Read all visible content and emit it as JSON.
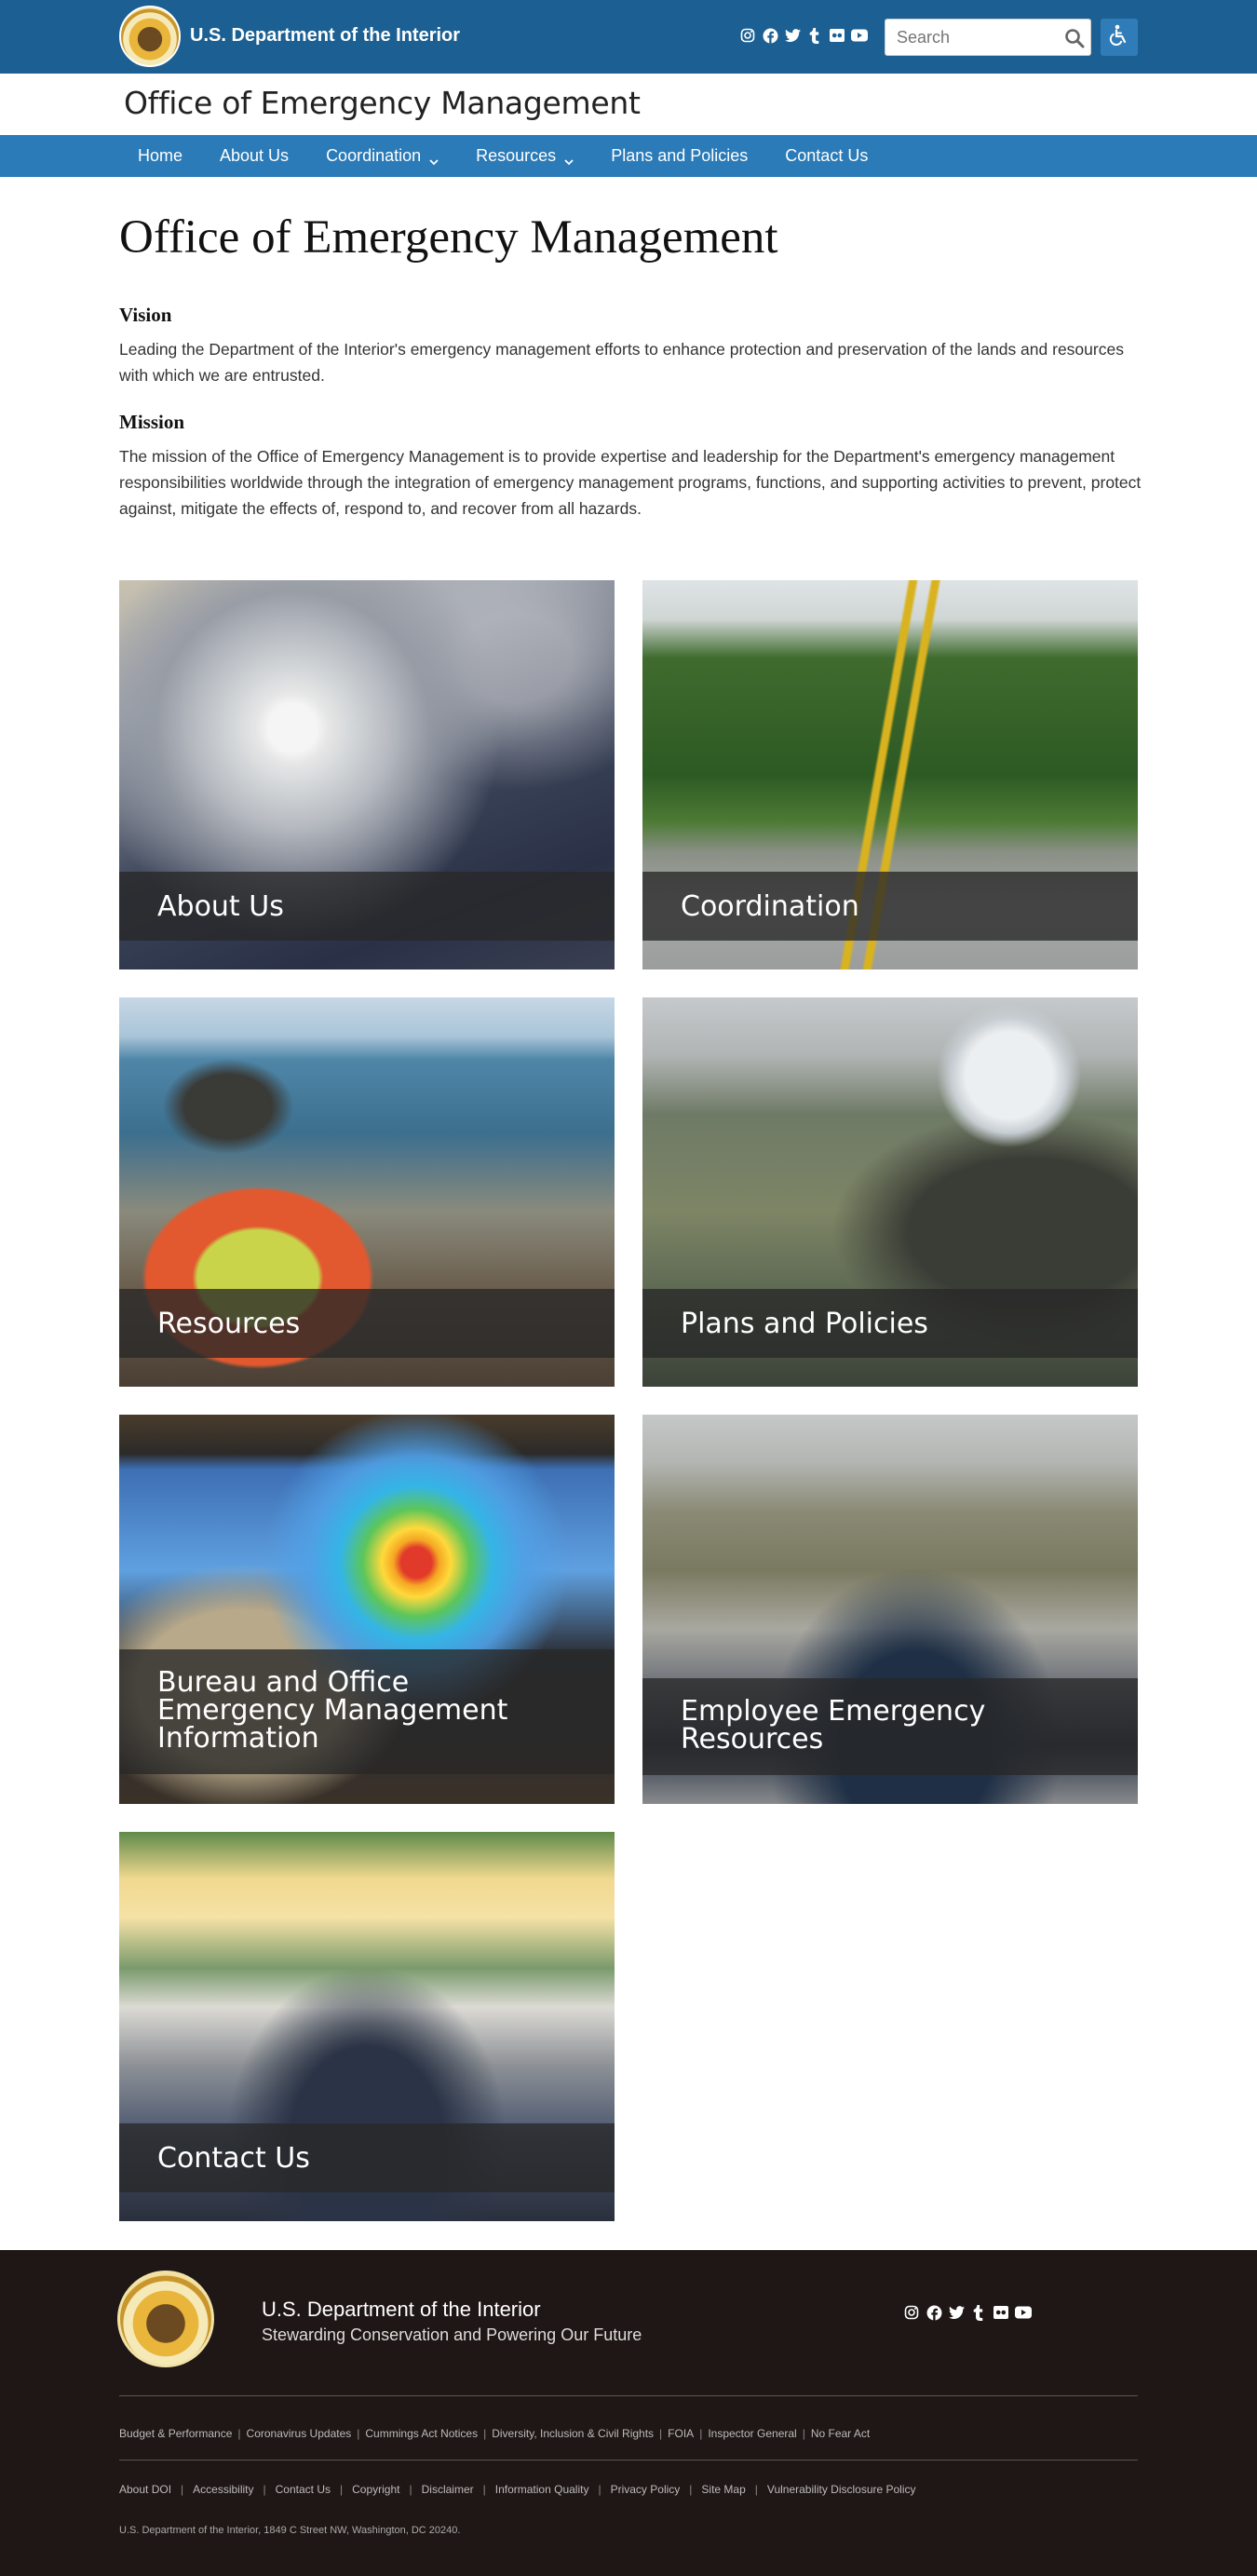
{
  "header": {
    "agency_name": "U.S. Department of the Interior",
    "search_placeholder": "Search",
    "social_icons": [
      "instagram-icon",
      "facebook-icon",
      "twitter-icon",
      "tumblr-icon",
      "flickr-icon",
      "youtube-icon"
    ],
    "colors": {
      "topbar": "#1c6093",
      "nav": "#2b7bb8"
    }
  },
  "site_title": "Office of Emergency Management",
  "nav": {
    "items": [
      {
        "label": "Home"
      },
      {
        "label": "About Us"
      },
      {
        "label": "Coordination"
      },
      {
        "label": "Resources"
      },
      {
        "label": "Plans and Policies"
      },
      {
        "label": "Contact Us"
      }
    ]
  },
  "main": {
    "title": "Office of Emergency Management",
    "vision_heading": "Vision",
    "vision_text": "Leading the Department of the Interior's emergency management efforts to enhance protection and preservation of the lands and resources with which we are entrusted.",
    "mission_heading": "Mission",
    "mission_text": "The mission of the Office of Emergency Management is to provide expertise and leadership for the Department's emergency management responsibilities worldwide through the integration of emergency management programs, functions, and supporting activities to prevent, protect against, mitigate the effects of, respond to, and recover from all hazards."
  },
  "cards": [
    {
      "label": "About Us",
      "image": "hurricane satellite image"
    },
    {
      "label": "Coordination",
      "image": "crew clearing fallen tree from road"
    },
    {
      "label": "Resources",
      "image": "USGS worker photographing pier"
    },
    {
      "label": "Plans and Policies",
      "image": "helicopter crew photographer"
    },
    {
      "label": "Bureau and Office Emergency Management Information",
      "image": "park ranger viewing hurricane radar"
    },
    {
      "label": "Employee Emergency Resources",
      "image": "group briefing at overlook"
    },
    {
      "label": "Contact Us",
      "image": "crowd at pavilion briefing"
    }
  ],
  "footer": {
    "agency_name": "U.S. Department of the Interior",
    "tagline": "Stewarding Conservation and Powering Our Future",
    "links_row1": [
      "Budget & Performance",
      "Coronavirus Updates",
      "Cummings Act Notices",
      "Diversity, Inclusion & Civil Rights",
      "FOIA",
      "Inspector General",
      "No Fear Act"
    ],
    "links_row2": [
      "About DOI",
      "Accessibility",
      "Contact Us",
      "Copyright",
      "Disclaimer",
      "Information Quality",
      "Privacy Policy",
      "Site Map",
      "Vulnerability Disclosure Policy"
    ],
    "address": "U.S. Department of the Interior, 1849 C Street NW, Washington, DC 20240."
  }
}
